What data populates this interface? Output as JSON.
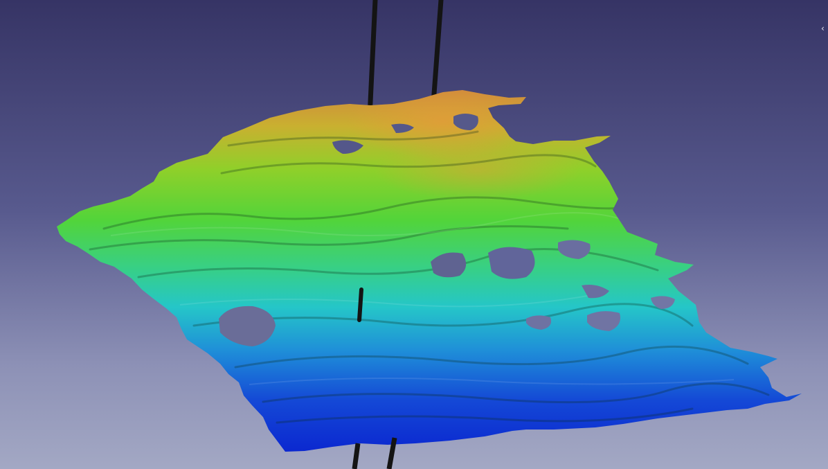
{
  "viewer": {
    "background_top": "#363465",
    "background_bottom": "#a3a8c4"
  },
  "surface": {
    "name": "horizon-surface",
    "colormap": [
      "#0b28d0",
      "#1f6ad8",
      "#21a6d2",
      "#2dcfb5",
      "#44d35e",
      "#6ed62a",
      "#b7cf2a",
      "#dca53a",
      "#d08a3c"
    ]
  },
  "wells": {
    "count": 2,
    "color": "#141414"
  },
  "controls": {
    "panel_toggle_icon": "chevron-left-icon",
    "panel_toggle_glyph": "‹"
  }
}
